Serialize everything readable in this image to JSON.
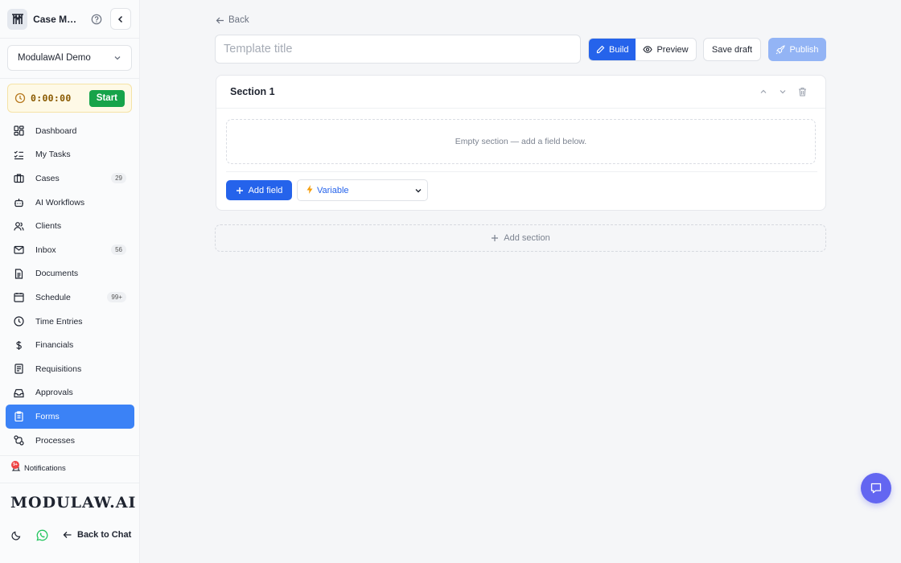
{
  "sidebar": {
    "app_title": "Case Man...",
    "org_name": "ModulawAI Demo",
    "timer": {
      "value": "0:00:00",
      "start_label": "Start"
    },
    "items": [
      {
        "label": "Dashboard",
        "icon": "dashboard-icon",
        "badge": ""
      },
      {
        "label": "My Tasks",
        "icon": "tasks-icon",
        "badge": ""
      },
      {
        "label": "Cases",
        "icon": "briefcase-icon",
        "badge": "29"
      },
      {
        "label": "AI Workflows",
        "icon": "bot-icon",
        "badge": ""
      },
      {
        "label": "Clients",
        "icon": "users-icon",
        "badge": ""
      },
      {
        "label": "Inbox",
        "icon": "mail-icon",
        "badge": "56"
      },
      {
        "label": "Documents",
        "icon": "document-icon",
        "badge": ""
      },
      {
        "label": "Schedule",
        "icon": "calendar-icon",
        "badge": "99+"
      },
      {
        "label": "Time Entries",
        "icon": "clock-icon",
        "badge": ""
      },
      {
        "label": "Financials",
        "icon": "dollar-icon",
        "badge": ""
      },
      {
        "label": "Requisitions",
        "icon": "requisition-icon",
        "badge": ""
      },
      {
        "label": "Approvals",
        "icon": "inbox-check-icon",
        "badge": ""
      },
      {
        "label": "Forms",
        "icon": "clipboard-icon",
        "badge": "",
        "active": true
      },
      {
        "label": "Processes",
        "icon": "workflow-icon",
        "badge": ""
      }
    ],
    "notifications": {
      "label": "Notifications",
      "count": "9+"
    },
    "brand": "MODULAW.AI",
    "back_to_chat": "Back to Chat"
  },
  "editor": {
    "back_label": "Back",
    "title_placeholder": "Template title",
    "title_value": "",
    "mode_tabs": [
      {
        "label": "Build",
        "active": true
      },
      {
        "label": "Preview",
        "active": false
      }
    ],
    "save_draft_label": "Save draft",
    "publish_label": "Publish",
    "sections": [
      {
        "title": "Section 1",
        "empty_text": "Empty section — add a field below.",
        "add_field_label": "Add field",
        "field_type_selected": "Variable"
      }
    ],
    "add_section_label": "Add section"
  },
  "colors": {
    "accent": "#2563eb",
    "active_nav": "#3b82f6",
    "timer_start": "#16a34a",
    "publish_disabled": "#93b4f5",
    "chat_fab": "#6366f1"
  }
}
